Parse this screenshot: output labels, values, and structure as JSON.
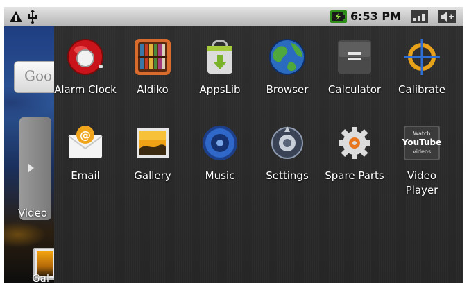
{
  "status_bar": {
    "time": "6:53 PM",
    "icons": [
      "warning-icon",
      "usb-icon",
      "battery-charging-icon",
      "signal-strength-icon",
      "volume-icon"
    ]
  },
  "home": {
    "search_text": "Goo",
    "shortcut_video": "Video",
    "shortcut_gallery": "Gal"
  },
  "apps": [
    {
      "label": "Alarm Clock",
      "icon": "alarm-clock-icon"
    },
    {
      "label": "Aldiko",
      "icon": "aldiko-icon"
    },
    {
      "label": "AppsLib",
      "icon": "appslib-icon"
    },
    {
      "label": "Browser",
      "icon": "browser-icon"
    },
    {
      "label": "Calculator",
      "icon": "calculator-icon"
    },
    {
      "label": "Calibrate",
      "icon": "calibrate-icon"
    },
    {
      "label": "Email",
      "icon": "email-icon"
    },
    {
      "label": "Gallery",
      "icon": "gallery-icon"
    },
    {
      "label": "Music",
      "icon": "music-icon"
    },
    {
      "label": "Settings",
      "icon": "settings-icon"
    },
    {
      "label": "Spare Parts",
      "icon": "spare-parts-icon"
    },
    {
      "label": "Video Player",
      "icon": "video-player-icon"
    }
  ],
  "video_icon_text": {
    "top": "Watch",
    "mid": "YouTube",
    "bottom": "videos"
  }
}
